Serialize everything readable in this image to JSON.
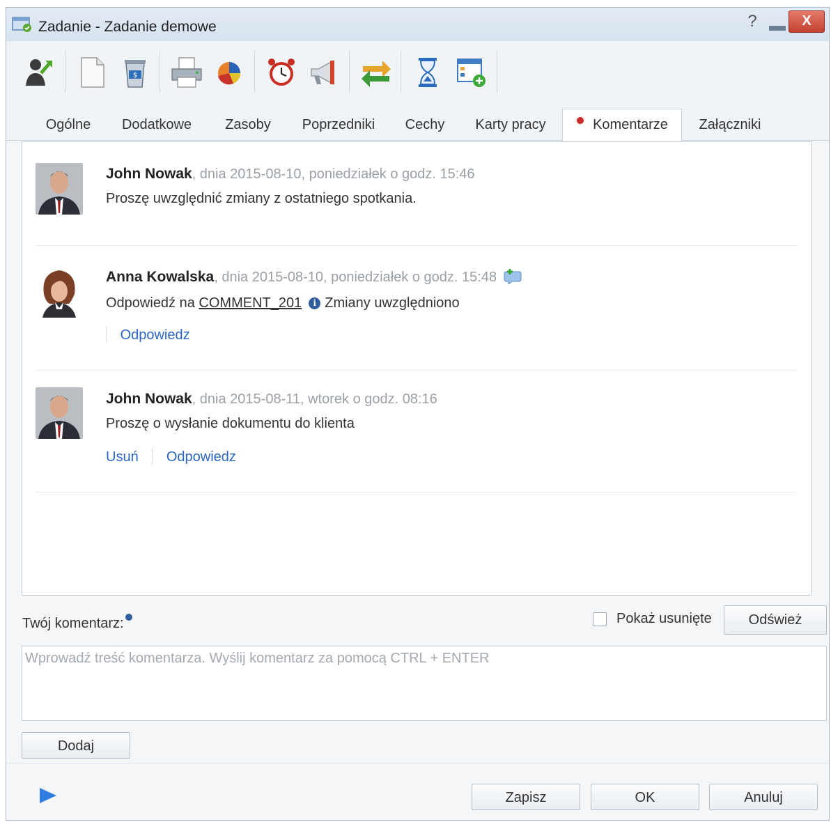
{
  "window": {
    "title": "Zadanie - Zadanie demowe",
    "help_glyph": "?",
    "close_glyph": "X"
  },
  "toolbar": {
    "icons": [
      "assign-icon",
      "new-document-icon",
      "trash-icon",
      "print-icon",
      "chart-icon",
      "alarm-clock-icon",
      "megaphone-icon",
      "transfer-icon",
      "hourglass-icon",
      "add-view-icon"
    ]
  },
  "tabs": [
    {
      "label": "Ogólne"
    },
    {
      "label": "Dodatkowe"
    },
    {
      "label": "Zasoby"
    },
    {
      "label": "Poprzedniki"
    },
    {
      "label": "Cechy"
    },
    {
      "label": "Karty pracy"
    },
    {
      "label": "Komentarze",
      "active": true
    },
    {
      "label": "Załączniki"
    }
  ],
  "comments": [
    {
      "author": "John Nowak",
      "meta": ", dnia 2015-08-10, poniedziałek o godz. 15:46",
      "text": "Proszę uwzględnić zmiany z ostatniego spotkania."
    },
    {
      "author": "Anna Kowalska",
      "meta": ", dnia 2015-08-10, poniedziałek o godz. 15:48",
      "reply_prefix": "Odpowiedź na ",
      "reply_ref": "COMMENT_201",
      "text": "Zmiany uwzględniono",
      "actions": {
        "reply": "Odpowiedz"
      }
    },
    {
      "author": "John Nowak",
      "meta": ", dnia 2015-08-11, wtorek o godz. 08:16",
      "text": "Proszę o wysłanie dokumentu do klienta",
      "actions": {
        "delete": "Usuń",
        "reply": "Odpowiedz"
      }
    }
  ],
  "form": {
    "comment_label": "Twój komentarz:",
    "show_deleted_label": "Pokaż usunięte",
    "show_deleted_checked": false,
    "refresh_label": "Odśwież",
    "input_placeholder": "Wprowadź treść komentarza. Wyślij komentarz za pomocą CTRL + ENTER",
    "input_value": "",
    "add_label": "Dodaj"
  },
  "footer": {
    "save_label": "Zapisz",
    "ok_label": "OK",
    "cancel_label": "Anuluj"
  }
}
